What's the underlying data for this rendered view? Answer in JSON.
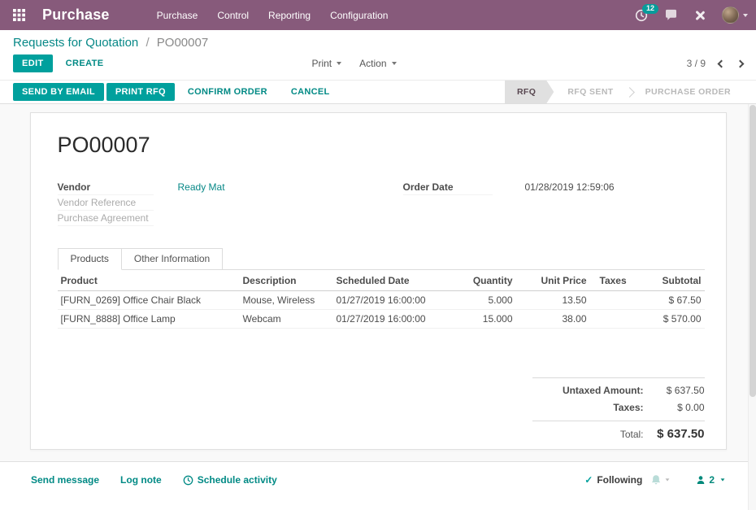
{
  "colors": {
    "navbar_bg": "#875a7b",
    "accent": "#00a09d",
    "link": "#078887",
    "badge_bg": "#00a09d"
  },
  "navbar": {
    "brand": "Purchase",
    "menus": [
      "Purchase",
      "Control",
      "Reporting",
      "Configuration"
    ],
    "activity_badge": "12"
  },
  "control_panel": {
    "breadcrumb_parent": "Requests for Quotation",
    "breadcrumb_separator": "/",
    "breadcrumb_current": "PO00007",
    "edit_label": "EDIT",
    "create_label": "CREATE",
    "print_label": "Print",
    "action_label": "Action",
    "pager_value": "3 / 9"
  },
  "statusbar": {
    "buttons": [
      {
        "label": "SEND BY EMAIL"
      },
      {
        "label": "PRINT RFQ"
      },
      {
        "label": "CONFIRM ORDER"
      },
      {
        "label": "CANCEL"
      }
    ],
    "states": [
      {
        "label": "RFQ",
        "active": true
      },
      {
        "label": "RFQ SENT",
        "active": false
      },
      {
        "label": "PURCHASE ORDER",
        "active": false
      }
    ]
  },
  "form": {
    "title": "PO00007",
    "fields": {
      "vendor_label": "Vendor",
      "vendor_value": "Ready Mat",
      "vendor_reference_label": "Vendor Reference",
      "purchase_agreement_label": "Purchase Agreement",
      "order_date_label": "Order Date",
      "order_date_value": "01/28/2019 12:59:06"
    },
    "tabs": [
      {
        "label": "Products",
        "active": true
      },
      {
        "label": "Other Information",
        "active": false
      }
    ],
    "table": {
      "headers": [
        "Product",
        "Description",
        "Scheduled Date",
        "Quantity",
        "Unit Price",
        "Taxes",
        "Subtotal"
      ],
      "rows": [
        {
          "product": "[FURN_0269] Office Chair Black",
          "description": "Mouse, Wireless",
          "scheduled_date": "01/27/2019 16:00:00",
          "quantity": "5.000",
          "unit_price": "13.50",
          "taxes": "",
          "subtotal": "$ 67.50"
        },
        {
          "product": "[FURN_8888] Office Lamp",
          "description": "Webcam",
          "scheduled_date": "01/27/2019 16:00:00",
          "quantity": "15.000",
          "unit_price": "38.00",
          "taxes": "",
          "subtotal": "$ 570.00"
        }
      ]
    },
    "totals": {
      "untaxed_label": "Untaxed Amount:",
      "untaxed_value": "$ 637.50",
      "taxes_label": "Taxes:",
      "taxes_value": "$ 0.00",
      "total_label": "Total:",
      "total_value": "$ 637.50"
    }
  },
  "chatter": {
    "send_message": "Send message",
    "log_note": "Log note",
    "schedule_activity": "Schedule activity",
    "following": "Following",
    "follower_count": "2"
  }
}
